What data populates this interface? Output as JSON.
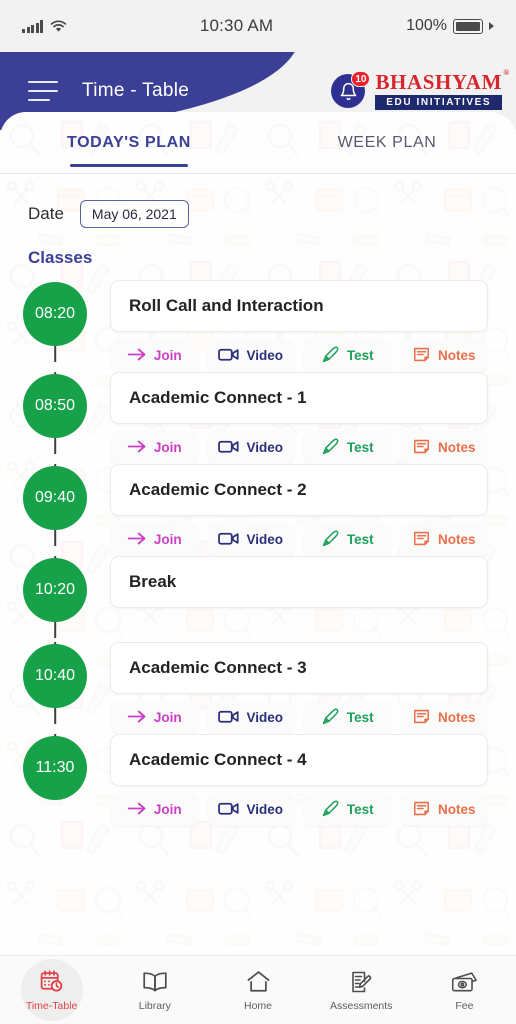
{
  "statusbar": {
    "time": "10:30 AM",
    "battery": "100%",
    "signal_icon": "signal-bars-icon",
    "wifi_icon": "wifi-icon",
    "battery_icon": "battery-icon"
  },
  "header": {
    "title": "Time - Table",
    "menu_icon": "hamburger-menu-icon",
    "bell_icon": "notification-bell-icon",
    "notification_count": "10",
    "logo_primary": "BHASHYAM",
    "logo_registered": "®",
    "logo_secondary": "EDU INITIATIVES",
    "navy": "#3b3f96",
    "logo_red": "#d7262f"
  },
  "tabs": [
    {
      "label": "TODAY'S PLAN",
      "active": true
    },
    {
      "label": "WEEK PLAN",
      "active": false
    }
  ],
  "date_row": {
    "label": "Date",
    "value": "May 06, 2021"
  },
  "classes_heading": "Classes",
  "action_labels": {
    "join": "Join",
    "video": "Video",
    "test": "Test",
    "notes": "Notes"
  },
  "action_icons": {
    "join": "arrow-right-icon",
    "video": "video-camera-icon",
    "test": "pen-nib-icon",
    "notes": "notes-document-icon"
  },
  "action_colors": {
    "join": "#cc3fc4",
    "video": "#2b2f7a",
    "test": "#20a05c",
    "notes": "#e8704a"
  },
  "timeline_dot_color": "#17a24a",
  "classes": [
    {
      "time": "08:20",
      "title": "Roll Call and Interaction",
      "has_actions": true
    },
    {
      "time": "08:50",
      "title": "Academic Connect - 1",
      "has_actions": true
    },
    {
      "time": "09:40",
      "title": "Academic Connect - 2",
      "has_actions": true
    },
    {
      "time": "10:20",
      "title": "Break",
      "has_actions": false
    },
    {
      "time": "10:40",
      "title": "Academic Connect - 3",
      "has_actions": true
    },
    {
      "time": "11:30",
      "title": "Academic Connect - 4",
      "has_actions": true
    }
  ],
  "bottomnav": [
    {
      "label": "Time-Table",
      "icon": "calendar-clock-icon",
      "active": true
    },
    {
      "label": "Library",
      "icon": "open-book-icon",
      "active": false
    },
    {
      "label": "Home",
      "icon": "home-icon",
      "active": false
    },
    {
      "label": "Assessments",
      "icon": "clipboard-pencil-icon",
      "active": false
    },
    {
      "label": "Fee",
      "icon": "banknotes-icon",
      "active": false
    }
  ]
}
